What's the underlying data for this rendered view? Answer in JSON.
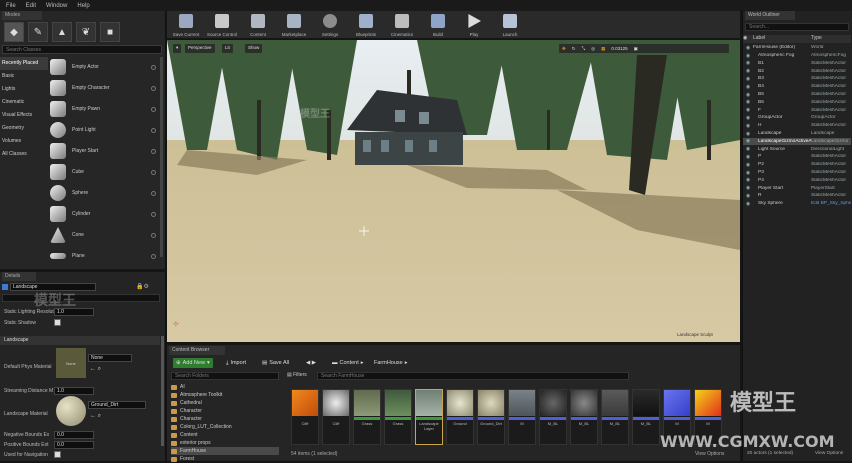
{
  "menu": [
    "File",
    "Edit",
    "Window",
    "Help"
  ],
  "modes": {
    "tab": "Modes",
    "search_placeholder": "Search Classes",
    "categories": [
      "Recently Placed",
      "Basic",
      "Lights",
      "Cinematic",
      "Visual Effects",
      "Geometry",
      "Volumes",
      "All Classes"
    ],
    "items": [
      "Empty Actor",
      "Empty Character",
      "Empty Pawn",
      "Point Light",
      "Player Start",
      "Cube",
      "Sphere",
      "Cylinder",
      "Cone",
      "Plane"
    ]
  },
  "details": {
    "tab": "Details",
    "actor_name": "Landscape",
    "static_lighting_label": "Static Lighting Resolution",
    "static_lighting_value": "1.0",
    "static_shadow_label": "Static Shadow",
    "section": "Landscape",
    "phys_label": "Default Phys Material",
    "phys_value": "None",
    "phys_thumb": "None",
    "stream_label": "Streaming Distance M",
    "stream_value": "1.0",
    "material_label": "Landscape Material",
    "material_value": "Ground_Dirt",
    "neg_label": "Negative Bounds Ex",
    "neg_value": "0.0",
    "pos_label": "Positive Bounds Ext",
    "pos_value": "0.0",
    "nav_label": "Used for Navigation"
  },
  "toolbar": [
    "Save Current",
    "Source Control",
    "Content",
    "Marketplace",
    "Settings",
    "Blueprints",
    "Cinematics",
    "Build",
    "Play",
    "Launch"
  ],
  "viewport": {
    "perspective": "Perspective",
    "lit": "Lit",
    "show": "Show",
    "value": "0.03125",
    "footer_text": "Landscape Sculpt"
  },
  "content_browser": {
    "tab": "Content Browser",
    "add_new": "Add New",
    "import": "Import",
    "save_all": "Save All",
    "path": [
      "Content",
      "FarmHouse"
    ],
    "filters": "Filters",
    "search_placeholder": "Search FarmHouse",
    "folder_search": "Search Folders",
    "folders": [
      "AI",
      "Atmosphere Toolkit",
      "Cathedral",
      "Character",
      "Character",
      "Colorg_LUT_Collection",
      "Content",
      "exterior props",
      "FarmHouse",
      "Forest"
    ],
    "asset_labels": [
      "Cliff",
      "Cliff",
      "Grass",
      "Grass",
      "Landscape Layer",
      "Ground",
      "Ground_Dirt",
      "M",
      "M_BL",
      "M_BL",
      "M_BL",
      "M_BL",
      "M",
      "M"
    ],
    "status": "54 items (1 selected)",
    "view_options": "View Options"
  },
  "outliner": {
    "tab": "World Outliner",
    "search_placeholder": "Search...",
    "col_label": "Label",
    "col_type": "Type",
    "rows": [
      {
        "label": "FarmHouse (Editor)",
        "type": "World",
        "indent": 0
      },
      {
        "label": "Atmospheric Fog",
        "type": "AtmosphericFog",
        "indent": 1
      },
      {
        "label": "B1",
        "type": "StaticMeshActor",
        "indent": 1
      },
      {
        "label": "B2",
        "type": "StaticMeshActor",
        "indent": 1
      },
      {
        "label": "B3",
        "type": "StaticMeshActor",
        "indent": 1
      },
      {
        "label": "B4",
        "type": "StaticMeshActor",
        "indent": 1
      },
      {
        "label": "B5",
        "type": "StaticMeshActor",
        "indent": 1
      },
      {
        "label": "B6",
        "type": "StaticMeshActor",
        "indent": 1
      },
      {
        "label": "F",
        "type": "StaticMeshActor",
        "indent": 1
      },
      {
        "label": "GroupActor",
        "type": "GroupActor",
        "indent": 1
      },
      {
        "label": "H",
        "type": "StaticMeshActor",
        "indent": 1
      },
      {
        "label": "Landscape",
        "type": "Landscape",
        "indent": 1
      },
      {
        "label": "LandscapeGizmoActiveActor",
        "type": "LandscapeGizmo",
        "indent": 1
      },
      {
        "label": "Light Source",
        "type": "DirectionalLight",
        "indent": 1
      },
      {
        "label": "P",
        "type": "StaticMeshActor",
        "indent": 1
      },
      {
        "label": "P2",
        "type": "StaticMeshActor",
        "indent": 1
      },
      {
        "label": "P3",
        "type": "StaticMeshActor",
        "indent": 1
      },
      {
        "label": "P4",
        "type": "StaticMeshActor",
        "indent": 1
      },
      {
        "label": "Player Start",
        "type": "PlayerStart",
        "indent": 1
      },
      {
        "label": "R",
        "type": "StaticMeshActor",
        "indent": 1
      },
      {
        "label": "Sky Sphere",
        "type": "Edit BP_Sky_Sphere",
        "indent": 1
      }
    ],
    "selected_index": 12,
    "footer": "20 actors (1 selected)",
    "view_options": "View Options"
  },
  "watermark": {
    "brand": "模型王",
    "url": "WWW.CGMXW.COM"
  },
  "colors": {
    "accent": "#2f7d2f",
    "selection": "#4b4b4b",
    "asset_bar_blue": "#4f5fd6",
    "asset_bar_green": "#3d9a3d"
  }
}
